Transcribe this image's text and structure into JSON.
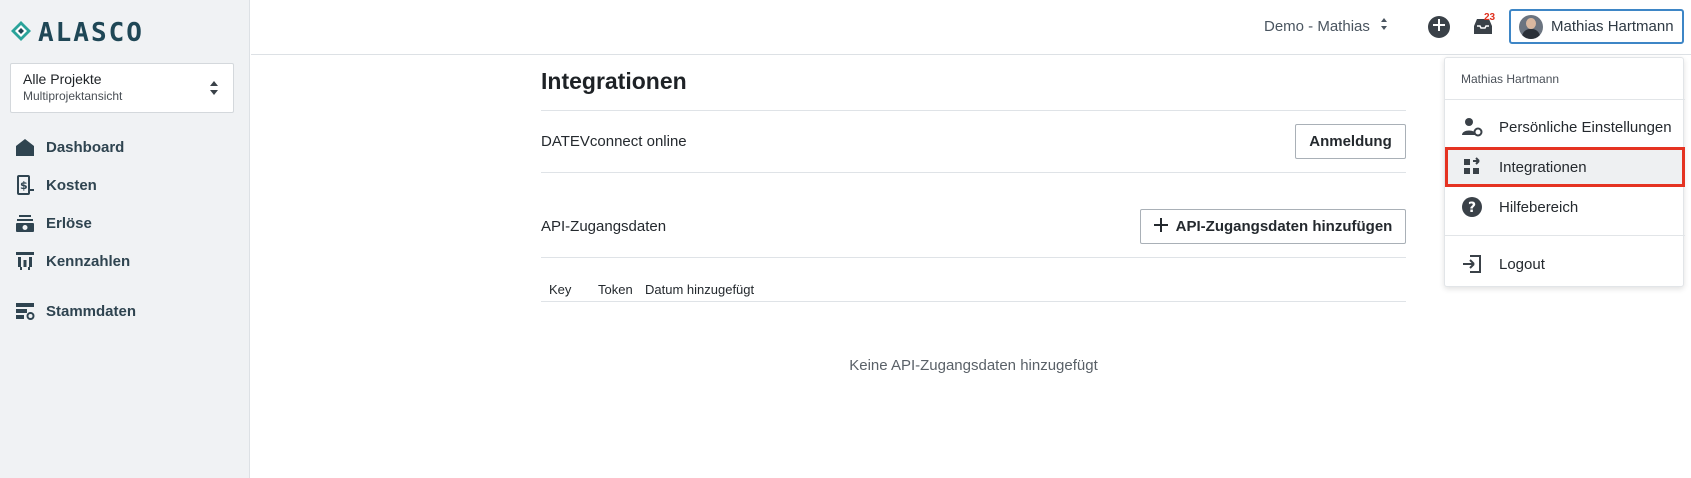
{
  "brand": {
    "name": "ALASCO"
  },
  "project_selector": {
    "title": "Alle Projekte",
    "subtitle": "Multiprojektansicht"
  },
  "sidebar": {
    "items": [
      {
        "label": "Dashboard",
        "icon": "home-icon"
      },
      {
        "label": "Kosten",
        "icon": "cost-icon"
      },
      {
        "label": "Erlöse",
        "icon": "revenue-icon"
      },
      {
        "label": "Kennzahlen",
        "icon": "chart-icon"
      },
      {
        "label": "Stammdaten",
        "icon": "master-data-icon"
      }
    ]
  },
  "topbar": {
    "environment": "Demo - Mathias",
    "notification_count": "23",
    "user_name": "Mathias Hartmann"
  },
  "main": {
    "title": "Integrationen",
    "datev": {
      "label": "DATEVconnect online",
      "button": "Anmeldung"
    },
    "api": {
      "label": "API-Zugangsdaten",
      "button": "API-Zugangsdaten hinzufügen"
    },
    "table": {
      "columns": [
        "Key",
        "Token",
        "Datum hinzugefügt"
      ]
    },
    "empty_message": "Keine API-Zugangsdaten hinzugefügt"
  },
  "user_menu": {
    "header": "Mathias Hartmann",
    "items": [
      {
        "label": "Persönliche Einstellungen",
        "icon": "user-settings-icon"
      },
      {
        "label": "Integrationen",
        "icon": "integrations-icon"
      },
      {
        "label": "Hilfebereich",
        "icon": "help-icon"
      },
      {
        "label": "Logout",
        "icon": "logout-icon"
      }
    ]
  },
  "colors": {
    "accent": "#3e86c6",
    "highlight": "#e53322",
    "sidebar_bg": "#f0f2f4",
    "brand": "#1f4756"
  }
}
